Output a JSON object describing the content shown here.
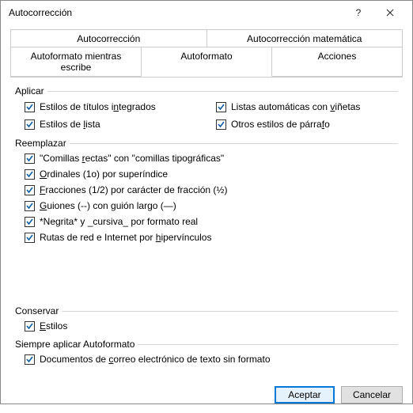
{
  "dialog": {
    "title": "Autocorrección",
    "help_label": "?",
    "close_label": "×"
  },
  "tabs": {
    "row1": [
      "Autocorrección",
      "Autocorrección matemática"
    ],
    "row2": [
      "Autoformato mientras escribe",
      "Autoformato",
      "Acciones"
    ],
    "active": "Autoformato"
  },
  "groups": {
    "apply": {
      "label": "Aplicar",
      "col1": [
        {
          "text_pre": "Estilos de títulos i",
          "mn": "n",
          "text_post": "tegrados",
          "checked": true
        },
        {
          "text_pre": "Estilos de ",
          "mn": "l",
          "text_post": "ista",
          "checked": true
        }
      ],
      "col2": [
        {
          "text_pre": "Listas automáticas con ",
          "mn": "v",
          "text_post": "iñetas",
          "checked": true
        },
        {
          "text_pre": "Otros estilos de párra",
          "mn": "f",
          "text_post": "o",
          "checked": true
        }
      ]
    },
    "replace": {
      "label": "Reemplazar",
      "items": [
        {
          "text_pre": "\"Comillas ",
          "mn": "r",
          "text_post": "ectas\" con \"comillas tipográficas\"",
          "checked": true
        },
        {
          "text_pre": "",
          "mn": "O",
          "text_post": "rdinales (1o) por superíndice",
          "checked": true
        },
        {
          "text_pre": "",
          "mn": "F",
          "text_post": "racciones (1/2) por carácter de fracción (½)",
          "checked": true
        },
        {
          "text_pre": "",
          "mn": "G",
          "text_post": "uiones (--) con guión largo (—)",
          "checked": true
        },
        {
          "text_pre": "*Negrita* y _cursiva_ por formato real",
          "mn": "",
          "text_post": "",
          "checked": true
        },
        {
          "text_pre": "Rutas de red e Internet por ",
          "mn": "h",
          "text_post": "ipervínculos",
          "checked": true
        }
      ]
    },
    "preserve": {
      "label": "Conservar",
      "items": [
        {
          "text_pre": "",
          "mn": "E",
          "text_post": "stilos",
          "checked": true
        }
      ]
    },
    "always": {
      "label": "Siempre aplicar Autoformato",
      "items": [
        {
          "text_pre": "Documentos de ",
          "mn": "c",
          "text_post": "orreo electrónico de texto sin formato",
          "checked": true
        }
      ]
    }
  },
  "buttons": {
    "ok": "Aceptar",
    "cancel": "Cancelar"
  }
}
